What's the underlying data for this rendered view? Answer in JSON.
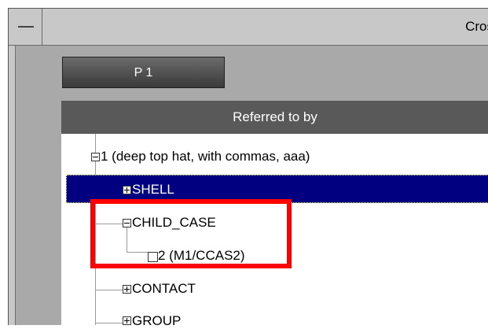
{
  "window": {
    "title_partial": "Cros"
  },
  "tabs": [
    {
      "label": "P 1"
    }
  ],
  "table": {
    "header": "Referred to by"
  },
  "tree": {
    "root": {
      "label": "1 (deep top hat, with commas, aaa)",
      "expanded": true
    },
    "items": [
      {
        "label": "SHELL",
        "expanded": false,
        "selected": true
      },
      {
        "label": "CHILD_CASE",
        "expanded": true
      },
      {
        "label": "2 (M1/CCAS2)",
        "leaf": true
      },
      {
        "label": "CONTACT",
        "expanded": false
      },
      {
        "label": "GROUP",
        "expanded": false
      }
    ]
  },
  "colors": {
    "selection": "#000080",
    "highlight": "#ff0000",
    "header_bg": "#595959"
  }
}
